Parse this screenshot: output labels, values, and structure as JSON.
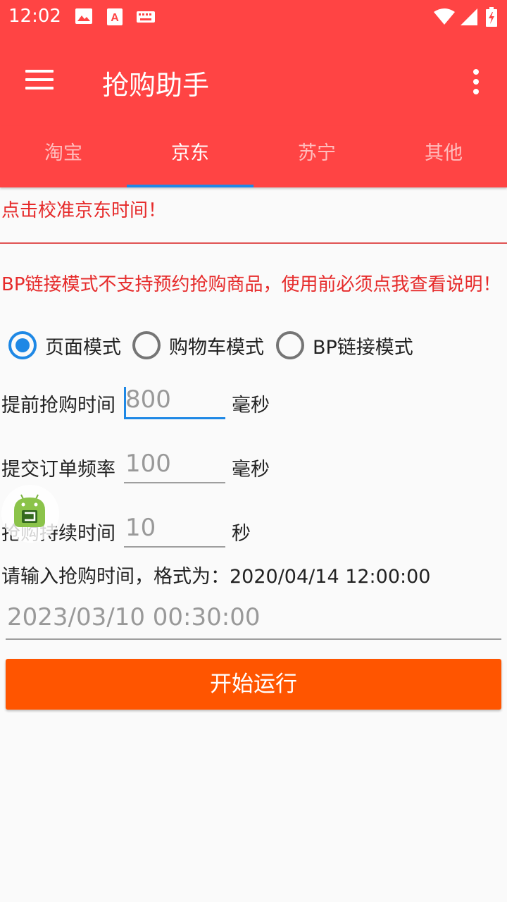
{
  "status_bar": {
    "time": "12:02",
    "icons": [
      "image-icon",
      "text-a-icon",
      "keyboard-icon",
      "wifi-icon",
      "signal-icon",
      "battery-charging-icon"
    ]
  },
  "app_bar": {
    "title": "抢购助手",
    "background_color": "#ff4444"
  },
  "tabs": [
    {
      "label": "淘宝",
      "active": false
    },
    {
      "label": "京东",
      "active": true
    },
    {
      "label": "苏宁",
      "active": false
    },
    {
      "label": "其他",
      "active": false
    }
  ],
  "calibrate_text": "点击校准京东时间！",
  "warning_text": "BP链接模式不支持预约抢购商品，使用前必须点我查看说明！",
  "modes": [
    {
      "label": "页面模式",
      "checked": true
    },
    {
      "label": "购物车模式",
      "checked": false
    },
    {
      "label": "BP链接模式",
      "checked": false
    }
  ],
  "fields": {
    "advance_time": {
      "label": "提前抢购时间",
      "placeholder": "800",
      "unit": "毫秒"
    },
    "submit_rate": {
      "label": "提交订单频率",
      "placeholder": "100",
      "unit": "毫秒"
    },
    "duration": {
      "label": "抢购持续时间",
      "placeholder": "10",
      "unit": "秒"
    }
  },
  "time_hint": "请输入抢购时间，格式为：2020/04/14 12:00:00",
  "time_input": {
    "placeholder": "2023/03/10 00:30:00"
  },
  "start_button": {
    "label": "开始运行",
    "color": "#ff5500"
  },
  "accent_color": "#1e88e5"
}
